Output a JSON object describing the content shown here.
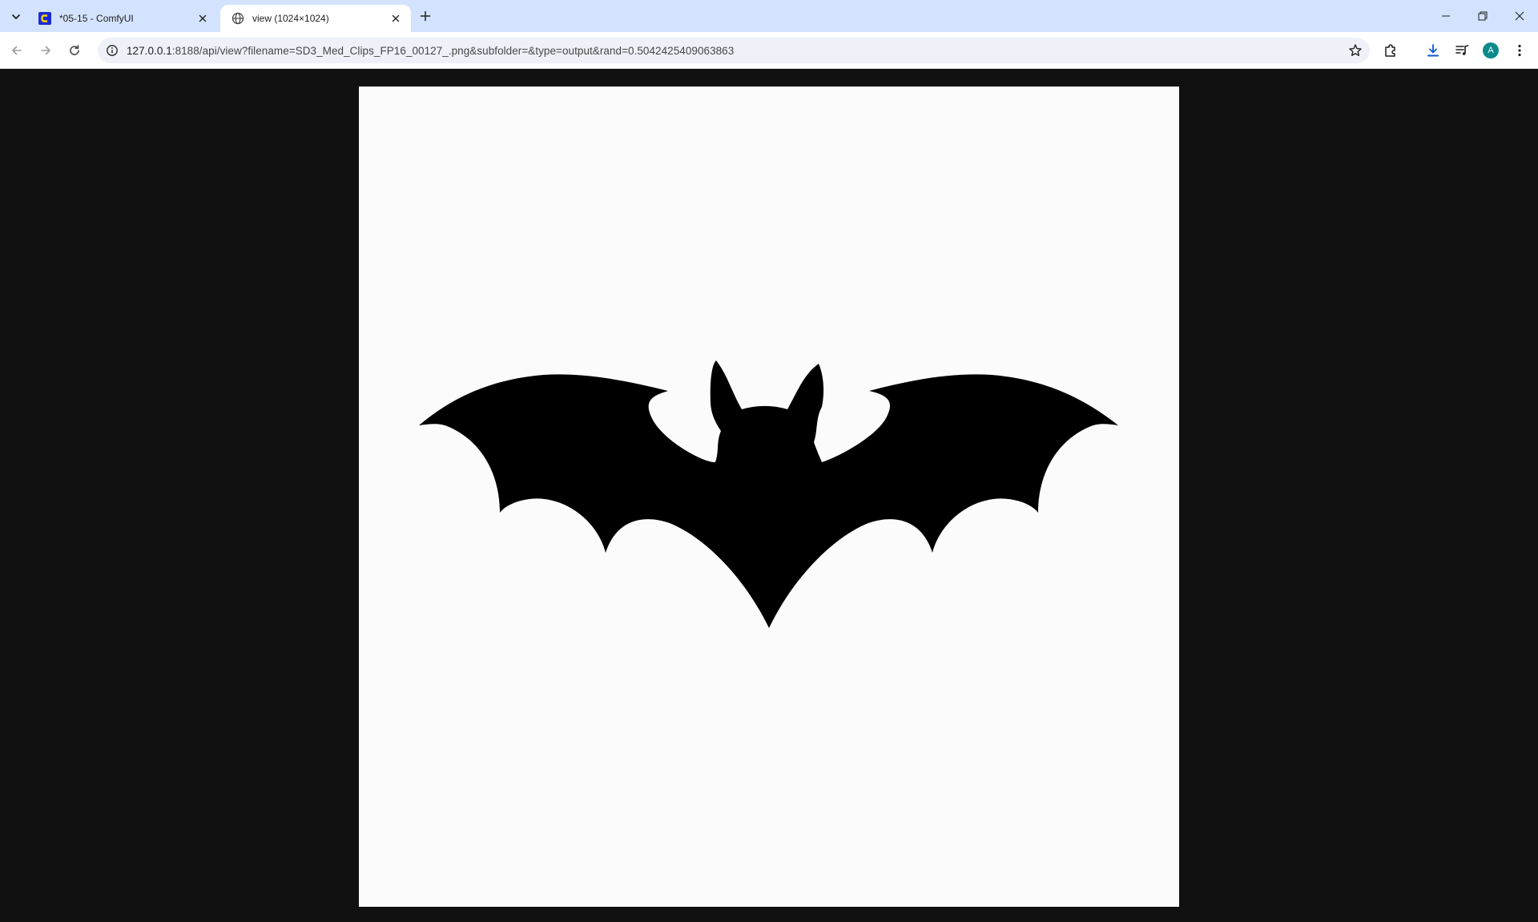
{
  "tabs": [
    {
      "title": "*05-15 - ComfyUI",
      "favicon": "comfyui-logo-icon",
      "active": false
    },
    {
      "title": "view (1024×1024)",
      "favicon": "globe-icon",
      "active": true
    }
  ],
  "toolbar": {
    "url_host": "127.0.0.1",
    "url_rest": ":8188/api/view?filename=SD3_Med_Clips_FP16_00127_.png&subfolder=&type=output&rand=0.5042425409063863",
    "avatar_letter": "A"
  },
  "image": {
    "description_icon": "bat-silhouette-icon",
    "background": "#fbfbfb",
    "figure_color": "#000000"
  },
  "colors": {
    "tabstrip": "#d3e3fd",
    "viewer_bg": "#111111",
    "accent_download": "#0b57d0",
    "avatar": "#0b8a8a"
  }
}
